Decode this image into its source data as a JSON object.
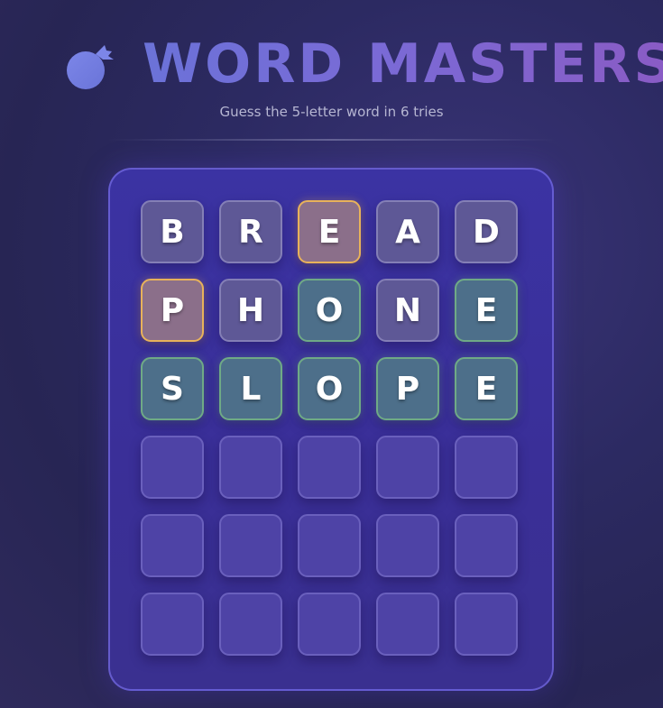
{
  "header": {
    "title": "WORD MASTERS",
    "subtitle": "Guess the 5-letter word in 6 tries",
    "logo_icon": "bomb-icon"
  },
  "colors": {
    "present": "#e8b25a",
    "correct": "#6faa86",
    "absent": "#5e5896"
  },
  "board": {
    "rows": [
      {
        "tiles": [
          {
            "letter": "B",
            "state": "absent"
          },
          {
            "letter": "R",
            "state": "absent"
          },
          {
            "letter": "E",
            "state": "present"
          },
          {
            "letter": "A",
            "state": "absent"
          },
          {
            "letter": "D",
            "state": "absent"
          }
        ]
      },
      {
        "tiles": [
          {
            "letter": "P",
            "state": "present"
          },
          {
            "letter": "H",
            "state": "absent"
          },
          {
            "letter": "O",
            "state": "correct"
          },
          {
            "letter": "N",
            "state": "absent"
          },
          {
            "letter": "E",
            "state": "correct"
          }
        ]
      },
      {
        "tiles": [
          {
            "letter": "S",
            "state": "correct"
          },
          {
            "letter": "L",
            "state": "correct"
          },
          {
            "letter": "O",
            "state": "correct"
          },
          {
            "letter": "P",
            "state": "correct"
          },
          {
            "letter": "E",
            "state": "correct"
          }
        ]
      },
      {
        "tiles": [
          {
            "letter": "",
            "state": "empty"
          },
          {
            "letter": "",
            "state": "empty"
          },
          {
            "letter": "",
            "state": "empty"
          },
          {
            "letter": "",
            "state": "empty"
          },
          {
            "letter": "",
            "state": "empty"
          }
        ]
      },
      {
        "tiles": [
          {
            "letter": "",
            "state": "empty"
          },
          {
            "letter": "",
            "state": "empty"
          },
          {
            "letter": "",
            "state": "empty"
          },
          {
            "letter": "",
            "state": "empty"
          },
          {
            "letter": "",
            "state": "empty"
          }
        ]
      },
      {
        "tiles": [
          {
            "letter": "",
            "state": "empty"
          },
          {
            "letter": "",
            "state": "empty"
          },
          {
            "letter": "",
            "state": "empty"
          },
          {
            "letter": "",
            "state": "empty"
          },
          {
            "letter": "",
            "state": "empty"
          }
        ]
      }
    ]
  }
}
